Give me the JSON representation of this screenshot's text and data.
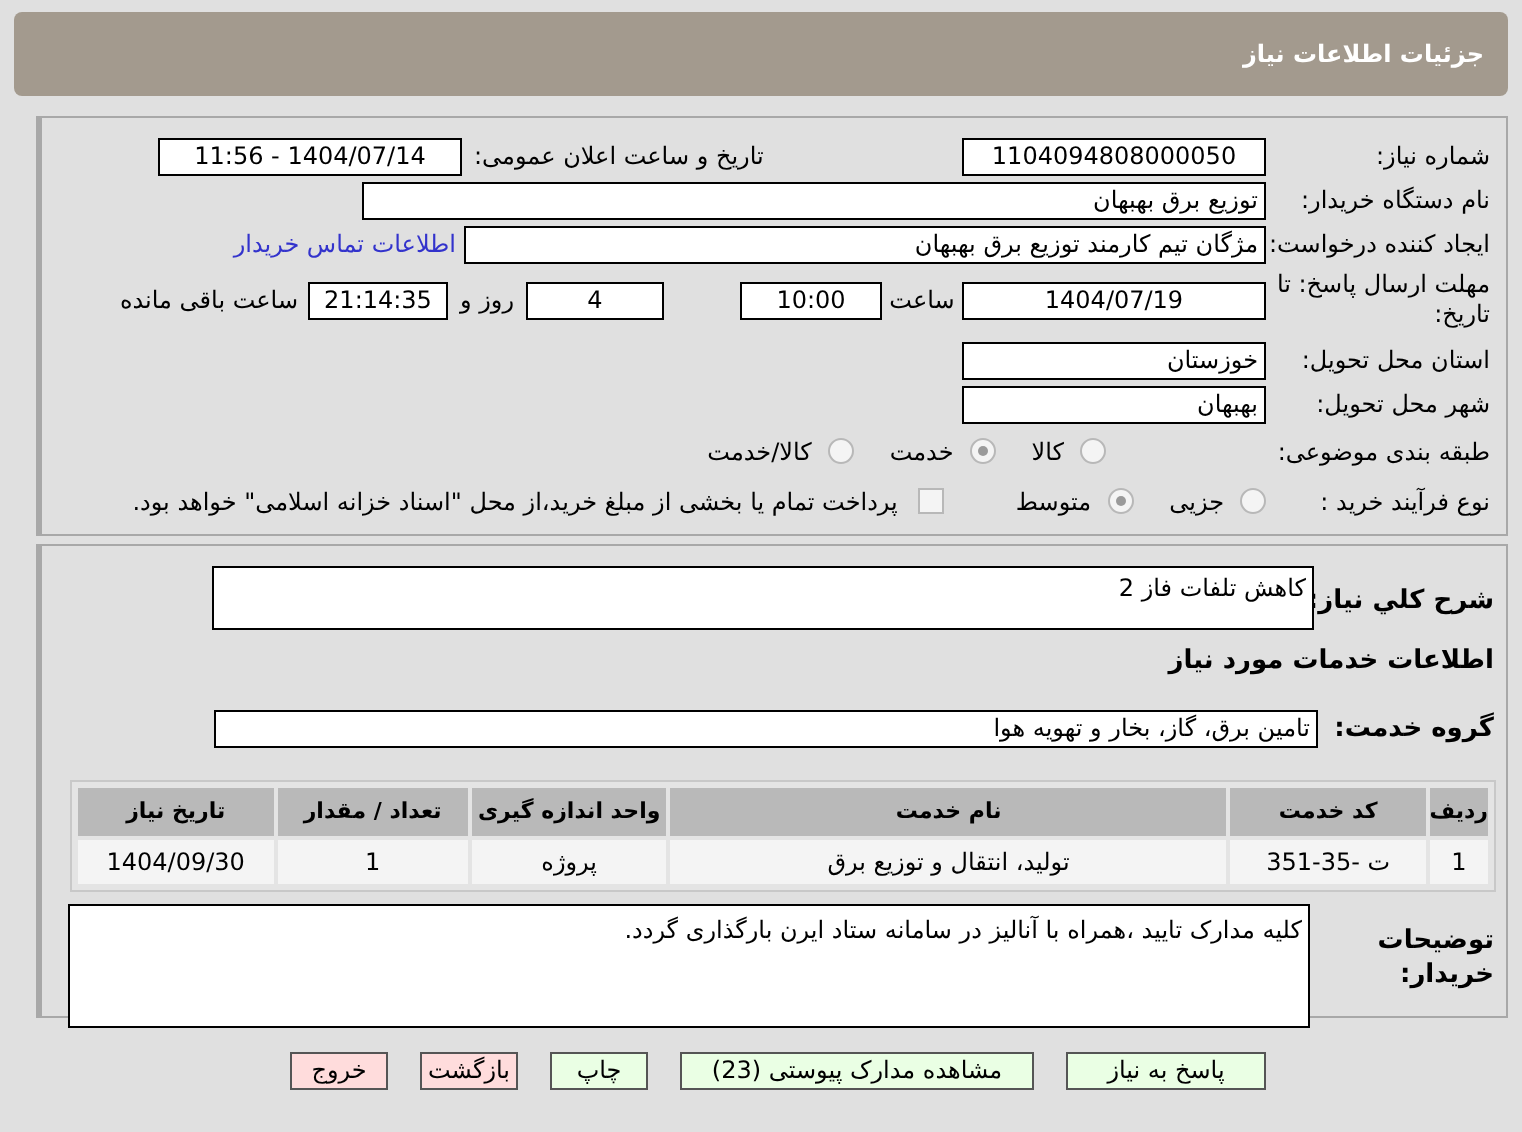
{
  "header": {
    "title": "جزئیات اطلاعات نیاز"
  },
  "need_number": {
    "label": "شماره نیاز:",
    "value": "1104094808000050"
  },
  "announce": {
    "label": "تاریخ و ساعت اعلان عمومی:",
    "value": "1404/07/14 - 11:56"
  },
  "buyer_org": {
    "label": "نام دستگاه خریدار:",
    "value": "توزیع برق بهبهان"
  },
  "requester": {
    "label": "ایجاد کننده درخواست:",
    "value": "مژگان تیم کارمند توزیع برق بهبهان",
    "contact_link": "اطلاعات تماس خریدار"
  },
  "deadline": {
    "label": "مهلت ارسال پاسخ: تا تاریخ:",
    "date": "1404/07/19",
    "time_label": "ساعت",
    "time": "10:00",
    "days": "4",
    "days_label": "روز و",
    "remaining": "21:14:35",
    "remaining_label": "ساعت باقی مانده"
  },
  "province": {
    "label": "استان محل تحویل:",
    "value": "خوزستان"
  },
  "city": {
    "label": "شهر محل تحویل:",
    "value": "بهبهان"
  },
  "category": {
    "label": "طبقه بندی موضوعی:",
    "options": [
      {
        "label": "کالا",
        "selected": false
      },
      {
        "label": "خدمت",
        "selected": true
      },
      {
        "label": "کالا/خدمت",
        "selected": false
      }
    ]
  },
  "purchase_type": {
    "label": "نوع فرآیند خرید :",
    "options": [
      {
        "label": "جزیی",
        "selected": false
      },
      {
        "label": "متوسط",
        "selected": true
      }
    ],
    "payment_checkbox": {
      "checked": false,
      "label": "پرداخت تمام یا بخشی از مبلغ خرید،از محل \"اسناد خزانه اسلامی\" خواهد بود."
    }
  },
  "description": {
    "label": "شرح کلي نياز:",
    "value": "کاهش تلفات فاز 2"
  },
  "services_title": "اطلاعات خدمات مورد نیاز",
  "service_group": {
    "label": "گروه خدمت:",
    "value": "تامین برق، گاز، بخار و تهویه هوا"
  },
  "table": {
    "columns": [
      "ردیف",
      "کد خدمت",
      "نام خدمت",
      "واحد اندازه گیری",
      "تعداد / مقدار",
      "تاریخ نیاز"
    ],
    "rows": [
      [
        "1",
        "ت -35-351",
        "تولید، انتقال و توزیع برق",
        "پروژه",
        "1",
        "1404/09/30"
      ]
    ]
  },
  "buyer_notes": {
    "label": "توضیحات خریدار:",
    "value": "کلیه مدارک تایید ،همراه با آنالیز در سامانه ستاد ایرن بارگذاری گردد."
  },
  "buttons": [
    {
      "label": "پاسخ به نیاز",
      "kind": "green"
    },
    {
      "label": "مشاهده مدارک پیوستی (23)",
      "kind": "green"
    },
    {
      "label": "چاپ",
      "kind": "green"
    },
    {
      "label": "بازگشت",
      "kind": "pink"
    },
    {
      "label": "خروج",
      "kind": "pink"
    }
  ]
}
